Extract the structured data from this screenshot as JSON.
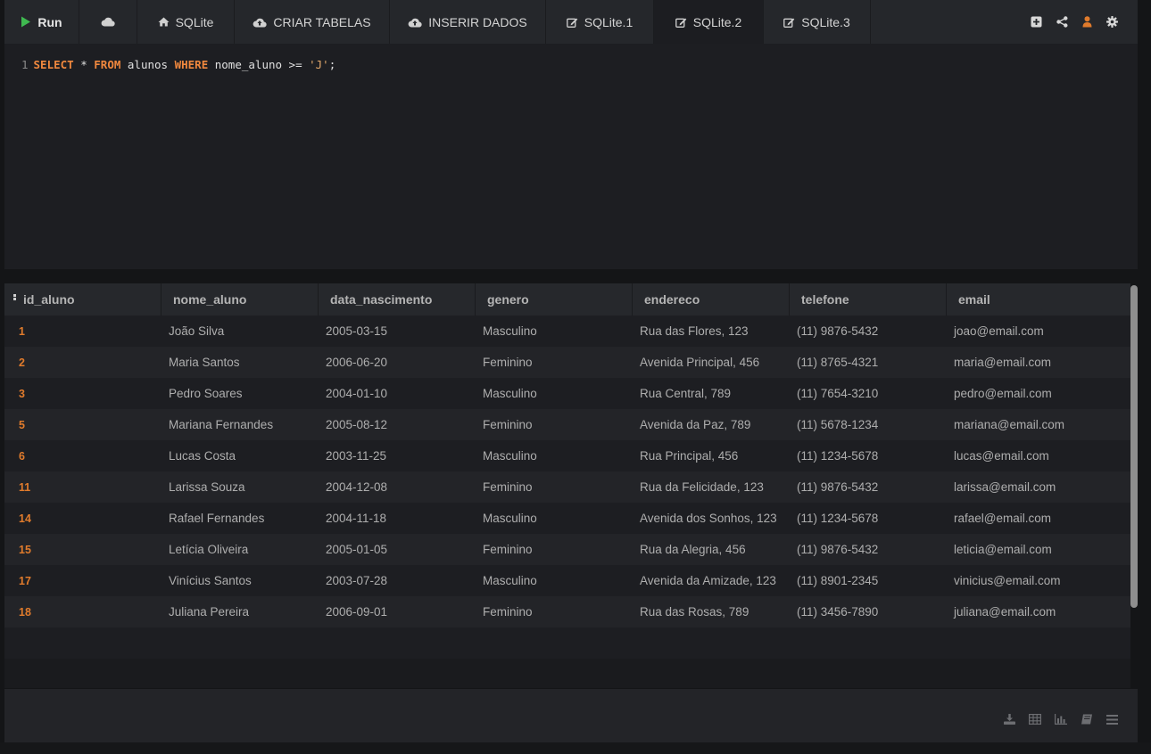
{
  "toolbar": {
    "run_label": "Run",
    "tabs": [
      {
        "label": "SQLite",
        "icon": "home-icon"
      },
      {
        "label": "CRIAR TABELAS",
        "icon": "cloud-upload-icon"
      },
      {
        "label": "INSERIR DADOS",
        "icon": "cloud-upload-icon"
      },
      {
        "label": "SQLite.1",
        "icon": "edit-icon"
      },
      {
        "label": "SQLite.2",
        "icon": "edit-icon",
        "active": true
      },
      {
        "label": "SQLite.3",
        "icon": "edit-icon"
      }
    ],
    "actions": [
      "add-icon",
      "share-icon",
      "user-icon",
      "gear-icon"
    ],
    "colors": {
      "run_icon": "#3fb950",
      "user_icon": "#e07b2c"
    }
  },
  "editor": {
    "line_number": "1",
    "tokens": {
      "select": "SELECT",
      "star": " * ",
      "from": "FROM",
      "table": " alunos ",
      "where": "WHERE",
      "condition": " nome_aluno >= ",
      "value": "'J'",
      "end": ";"
    }
  },
  "results": {
    "columns": [
      "id_aluno",
      "nome_aluno",
      "data_nascimento",
      "genero",
      "endereco",
      "telefone",
      "email"
    ],
    "rows": [
      [
        "1",
        "João Silva",
        "2005-03-15",
        "Masculino",
        "Rua das Flores, 123",
        "(11) 9876-5432",
        "joao@email.com"
      ],
      [
        "2",
        "Maria Santos",
        "2006-06-20",
        "Feminino",
        "Avenida Principal, 456",
        "(11) 8765-4321",
        "maria@email.com"
      ],
      [
        "3",
        "Pedro Soares",
        "2004-01-10",
        "Masculino",
        "Rua Central, 789",
        "(11) 7654-3210",
        "pedro@email.com"
      ],
      [
        "5",
        "Mariana Fernandes",
        "2005-08-12",
        "Feminino",
        "Avenida da Paz, 789",
        "(11) 5678-1234",
        "mariana@email.com"
      ],
      [
        "6",
        "Lucas Costa",
        "2003-11-25",
        "Masculino",
        "Rua Principal, 456",
        "(11) 1234-5678",
        "lucas@email.com"
      ],
      [
        "11",
        "Larissa Souza",
        "2004-12-08",
        "Feminino",
        "Rua da Felicidade, 123",
        "(11) 9876-5432",
        "larissa@email.com"
      ],
      [
        "14",
        "Rafael Fernandes",
        "2004-11-18",
        "Masculino",
        "Avenida dos Sonhos, 123",
        "(11) 1234-5678",
        "rafael@email.com"
      ],
      [
        "15",
        "Letícia Oliveira",
        "2005-01-05",
        "Feminino",
        "Rua da Alegria, 456",
        "(11) 9876-5432",
        "leticia@email.com"
      ],
      [
        "17",
        "Vinícius Santos",
        "2003-07-28",
        "Masculino",
        "Avenida da Amizade, 123",
        "(11) 8901-2345",
        "vinicius@email.com"
      ],
      [
        "18",
        "Juliana Pereira",
        "2006-09-01",
        "Feminino",
        "Rua das Rosas, 789",
        "(11) 3456-7890",
        "juliana@email.com"
      ]
    ],
    "id_color": "#e07b2c"
  },
  "footer": {
    "actions": [
      "download-icon",
      "table-view-icon",
      "chart-view-icon",
      "book-icon",
      "menu-icon"
    ]
  }
}
